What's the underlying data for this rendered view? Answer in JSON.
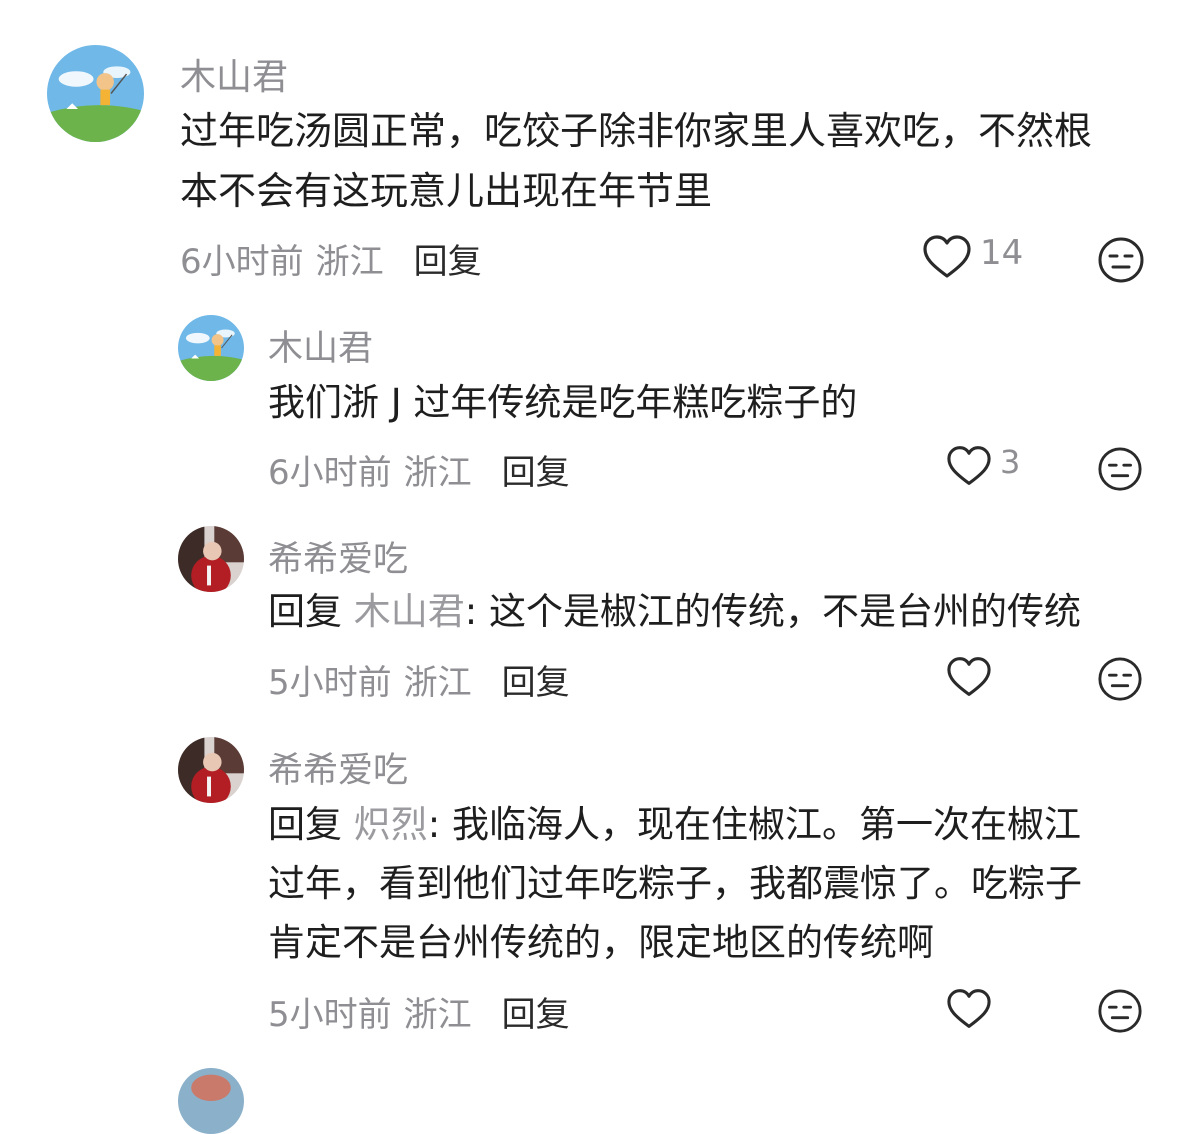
{
  "comments": [
    {
      "username": "木山君",
      "lines": [
        "过年吃汤圆正常，吃饺子除非你家里人喜欢吃，不然根",
        "本不会有这玩意儿出现在年节里"
      ],
      "time": "6小时前",
      "location": "浙江",
      "reply_label": "回复",
      "likes": "14",
      "avatar_icon": "cartoon-kite-avatar-icon"
    },
    {
      "username": "木山君",
      "lines": [
        "我们浙 J 过年传统是吃年糕吃粽子的"
      ],
      "time": "6小时前",
      "location": "浙江",
      "reply_label": "回复",
      "likes": "3",
      "avatar_icon": "cartoon-kite-avatar-icon"
    },
    {
      "username": "希希爱吃",
      "reply_prefix": "回复",
      "reply_to": "木山君",
      "lines": [
        ": 这个是椒江的传统，不是台州的传统"
      ],
      "time": "5小时前",
      "location": "浙江",
      "reply_label": "回复",
      "likes": "",
      "avatar_icon": "photo-avatar-icon"
    },
    {
      "username": "希希爱吃",
      "reply_prefix": "回复",
      "reply_to": "炽烈",
      "lines": [
        ": 我临海人，现在住椒江。第一次在椒江",
        "过年，看到他们过年吃粽子，我都震惊了。吃粽子",
        "肯定不是台州传统的，限定地区的传统啊"
      ],
      "time": "5小时前",
      "location": "浙江",
      "reply_label": "回复",
      "likes": "",
      "avatar_icon": "photo-avatar-icon"
    }
  ],
  "icons": {
    "like": "heart-outline-icon",
    "dislike": "meh-face-icon"
  },
  "colors": {
    "text": "#1e1e1e",
    "meta": "#8e8e93",
    "mention": "#9b9b9f",
    "icon": "#2a2a2a"
  }
}
